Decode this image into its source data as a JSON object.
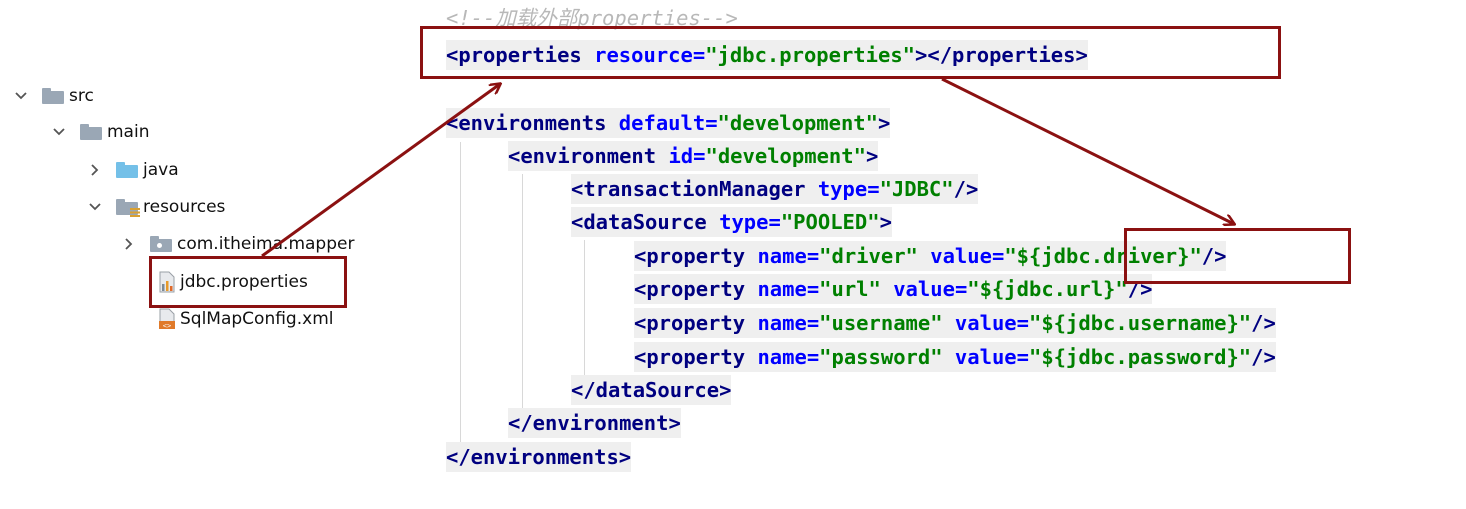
{
  "tree": {
    "items": [
      {
        "label": "src",
        "icon": "folder-icon",
        "expanded": true
      },
      {
        "label": "main",
        "icon": "folder-icon",
        "expanded": true
      },
      {
        "label": "java",
        "icon": "source-folder-icon",
        "expanded": false
      },
      {
        "label": "resources",
        "icon": "resources-folder-icon",
        "expanded": true
      },
      {
        "label": "com.itheima.mapper",
        "icon": "package-icon",
        "expanded": false
      },
      {
        "label": "jdbc.properties",
        "icon": "properties-file-icon"
      },
      {
        "label": "SqlMapConfig.xml",
        "icon": "xml-file-icon"
      }
    ]
  },
  "code": {
    "comment": "<!--加载外部properties-->",
    "lines": {
      "properties": {
        "open": "<properties",
        "attr": "resource",
        "eq": "=",
        "val": "\"jdbc.properties\"",
        "close": "></properties>"
      },
      "environments_open": {
        "open": "<environments",
        "attr": "default",
        "eq": "=",
        "val": "\"development\"",
        "close": ">"
      },
      "environment_open": {
        "open": "<environment",
        "attr": "id",
        "eq": "=",
        "val": "\"development\"",
        "close": ">"
      },
      "transaction": {
        "open": "<transactionManager",
        "attr": "type",
        "eq": "=",
        "val": "\"JDBC\"",
        "close": "/>"
      },
      "datasource_open": {
        "open": "<dataSource",
        "attr": "type",
        "eq": "=",
        "val": "\"POOLED\"",
        "close": ">"
      },
      "prop_driver": {
        "open": "<property",
        "a1": "name",
        "v1": "\"driver\"",
        "a2": "value",
        "v2": "\"${jdbc.driver}\"",
        "close": "/>"
      },
      "prop_url": {
        "open": "<property",
        "a1": "name",
        "v1": "\"url\"",
        "a2": "value",
        "v2": "\"${jdbc.url}\"",
        "close": "/>"
      },
      "prop_username": {
        "open": "<property",
        "a1": "name",
        "v1": "\"username\"",
        "a2": "value",
        "v2": "\"${jdbc.username}\"",
        "close": "/>"
      },
      "prop_password": {
        "open": "<property",
        "a1": "name",
        "v1": "\"password\"",
        "a2": "value",
        "v2": "\"${jdbc.password}\"",
        "close": "/>"
      },
      "datasource_close": "</dataSource>",
      "environment_close": "</environment>",
      "environments_close": "</environments>"
    }
  },
  "colors": {
    "highlight": "#8b1111",
    "tag": "#000080",
    "attr": "#0000ff",
    "value": "#008000",
    "line_bg": "#efefef"
  }
}
